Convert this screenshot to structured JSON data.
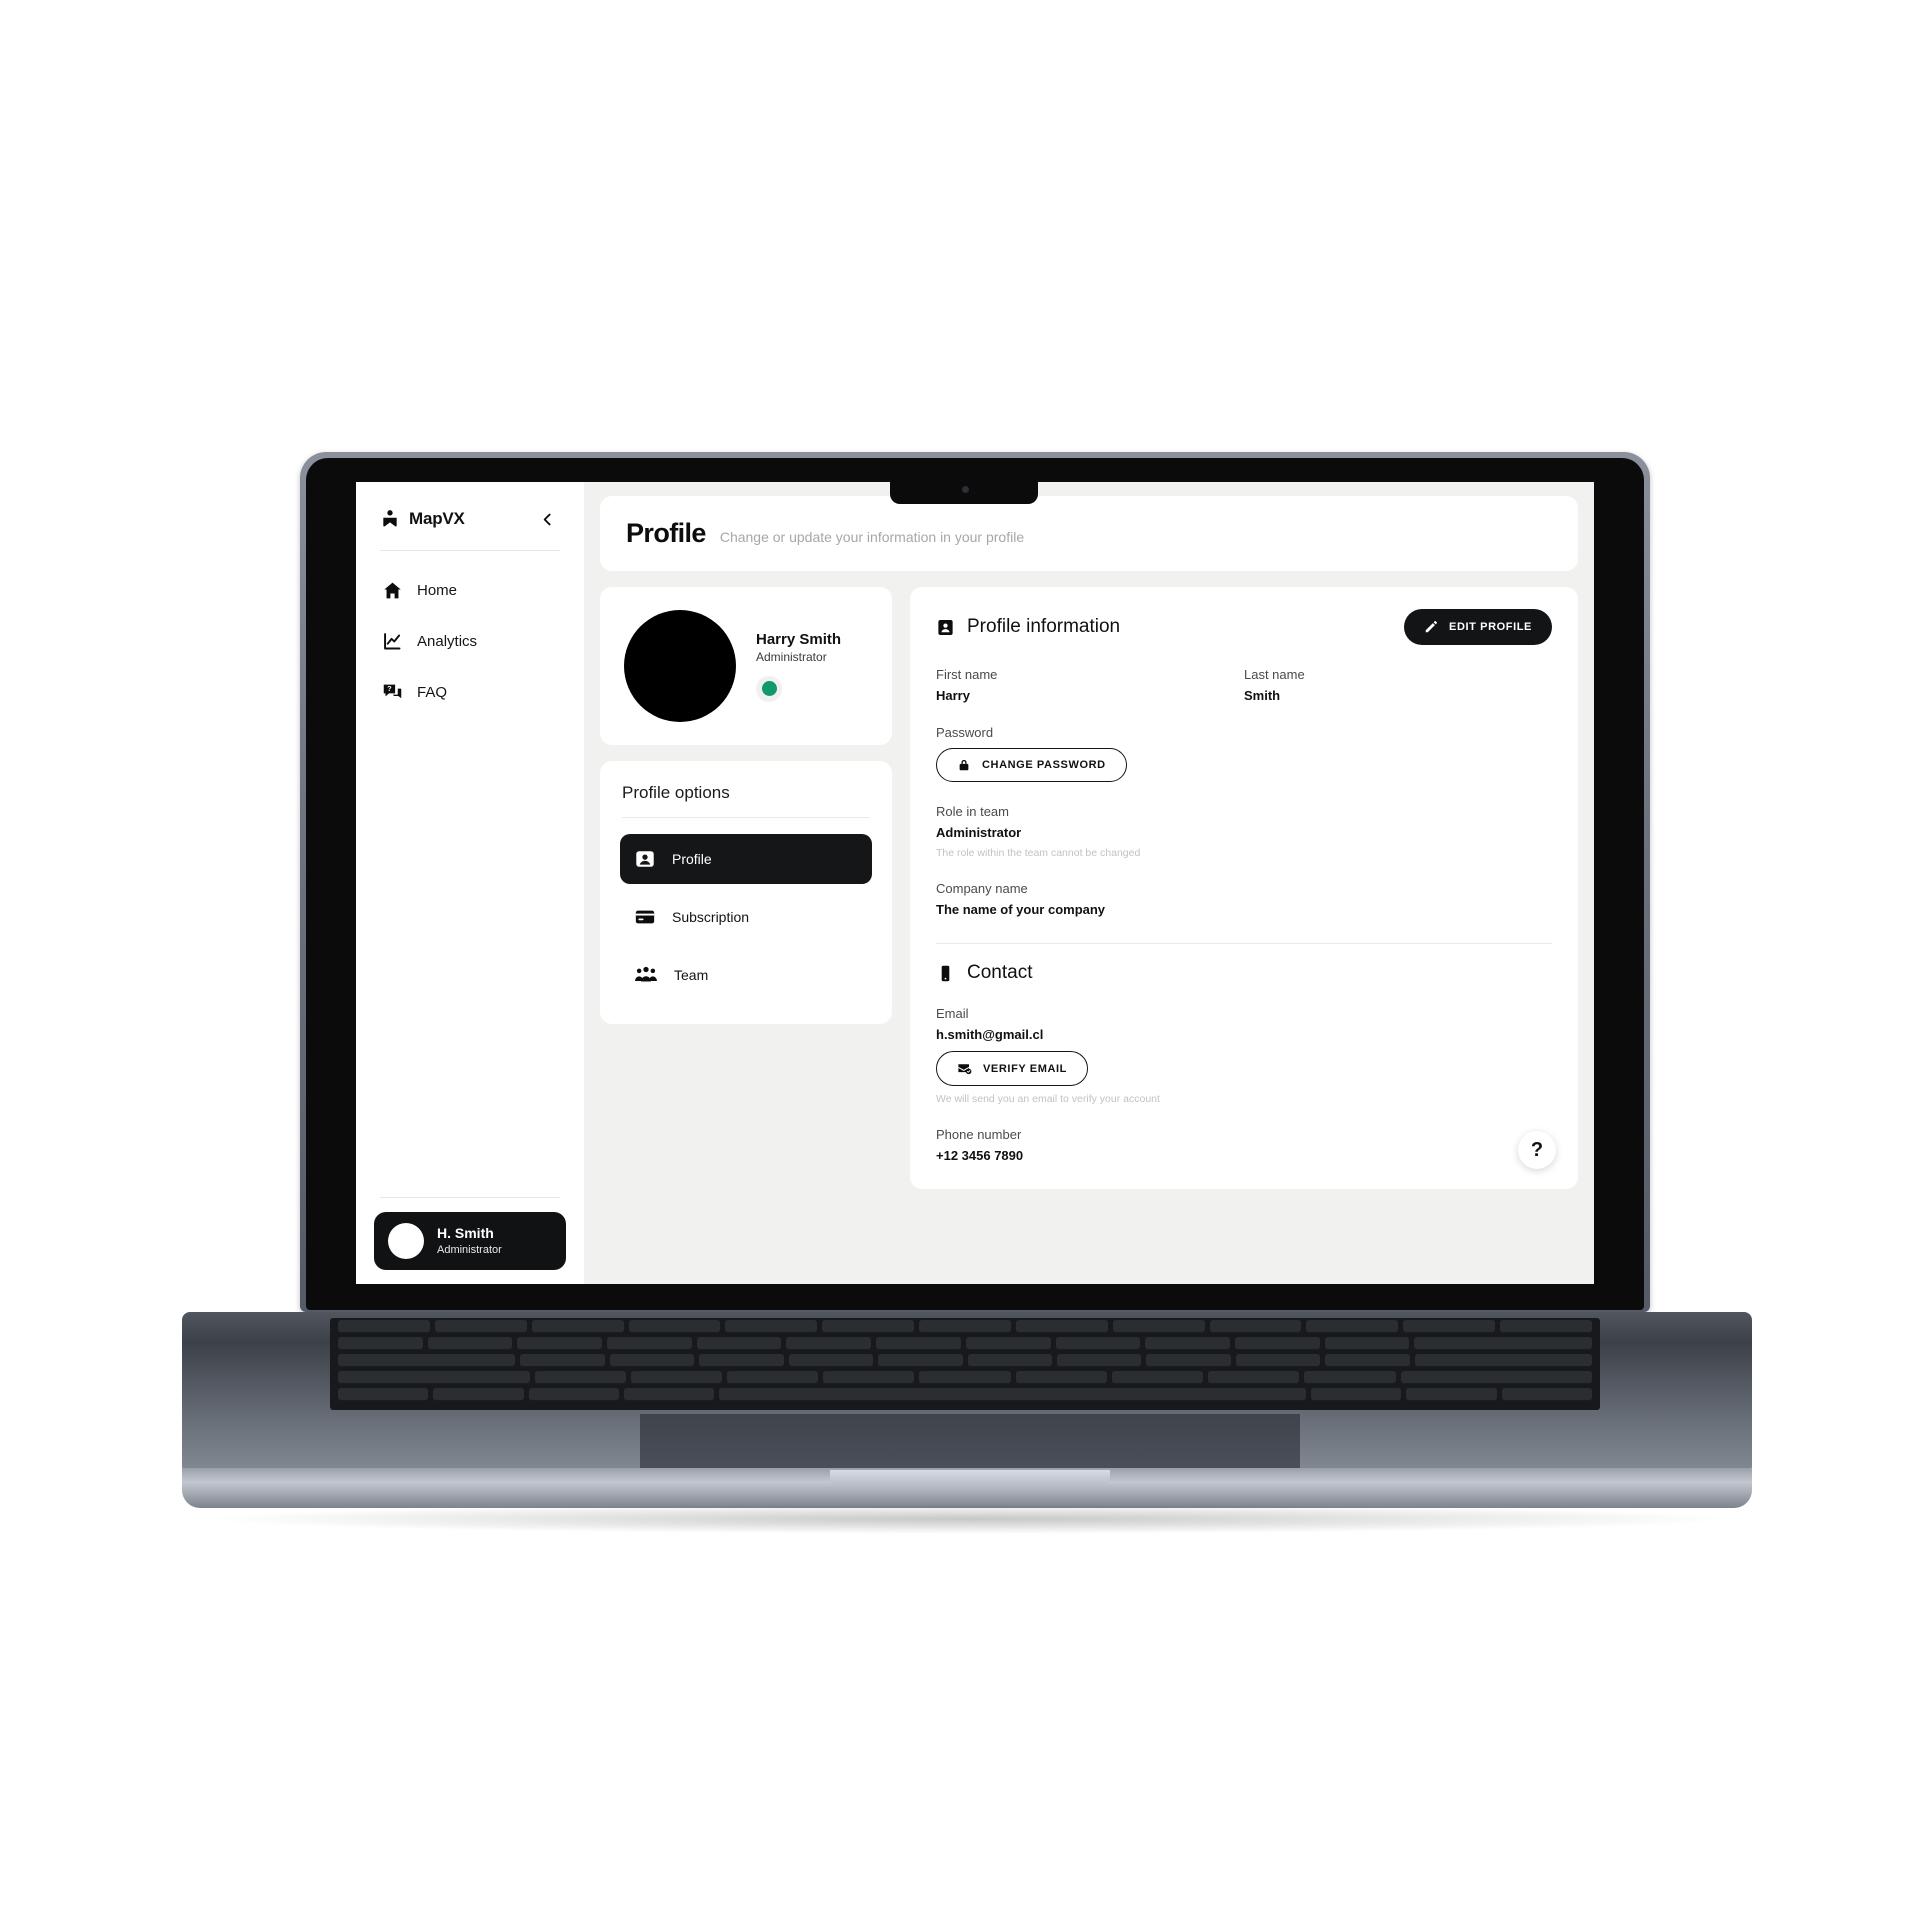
{
  "app": {
    "brand_name": "MapVX",
    "brand_icon": "map-pin-person-icon",
    "collapse_icon": "chevron-left-icon"
  },
  "sidebar": {
    "items": [
      {
        "label": "Home",
        "icon": "home-icon"
      },
      {
        "label": "Analytics",
        "icon": "line-chart-icon"
      },
      {
        "label": "FAQ",
        "icon": "question-chat-icon"
      }
    ],
    "user_chip": {
      "name": "H. Smith",
      "role": "Administrator",
      "avatar_icon": "avatar-icon"
    }
  },
  "header": {
    "title": "Profile",
    "subtitle": "Change or update your information in your profile"
  },
  "profile_card": {
    "name": "Harry Smith",
    "role": "Administrator",
    "avatar_icon": "avatar-icon",
    "status": "online",
    "status_color": "#10996b"
  },
  "profile_options": {
    "title": "Profile options",
    "items": [
      {
        "label": "Profile",
        "icon": "id-card-icon",
        "active": true
      },
      {
        "label": "Subscription",
        "icon": "credit-card-icon",
        "active": false
      },
      {
        "label": "Team",
        "icon": "people-group-icon",
        "active": false
      }
    ]
  },
  "profile_information": {
    "section_title": "Profile information",
    "section_icon": "id-badge-icon",
    "edit_button": {
      "label": "EDIT PROFILE",
      "icon": "pencil-icon"
    },
    "first_name": {
      "label": "First name",
      "value": "Harry"
    },
    "last_name": {
      "label": "Last name",
      "value": "Smith"
    },
    "password": {
      "label": "Password",
      "button": {
        "label": "CHANGE PASSWORD",
        "icon": "lock-icon"
      }
    },
    "role_in_team": {
      "label": "Role in team",
      "value": "Administrator",
      "hint": "The role within the team cannot be changed"
    },
    "company_name": {
      "label": "Company name",
      "value": "The name of your company"
    }
  },
  "contact": {
    "section_title": "Contact",
    "section_icon": "mobile-phone-icon",
    "email": {
      "label": "Email",
      "value": "h.smith@gmail.cl",
      "button": {
        "label": "VERIFY EMAIL",
        "icon": "mail-check-icon"
      },
      "hint": "We will send you an email to verify your account"
    },
    "phone": {
      "label": "Phone number",
      "value": "+12 3456 7890"
    }
  },
  "help_fab": {
    "label": "?",
    "icon": "question-mark-icon"
  },
  "colors": {
    "accent": "#131415",
    "surface": "#ffffff",
    "background": "#f1f1ef",
    "status_online": "#10996b",
    "muted_text": "#a7a7a7"
  }
}
